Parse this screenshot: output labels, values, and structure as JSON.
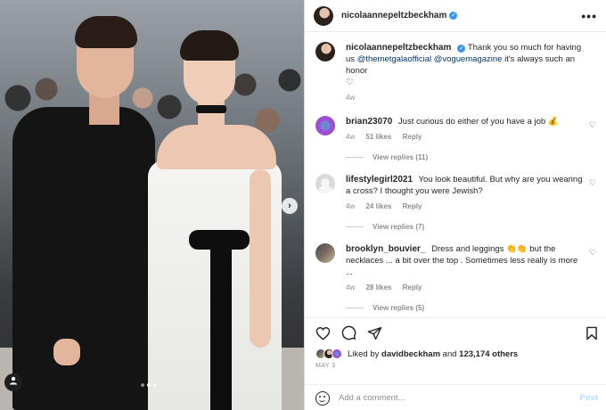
{
  "post": {
    "author": "nicolaannepeltzbeckham",
    "caption_text": "Thank you so much for having us",
    "caption_mention_1": "@themetgalaofficial",
    "caption_mention_2": "@voguemagazine",
    "caption_end": "it's always such an honor",
    "caption_emoji": "♡",
    "caption_age": "4w"
  },
  "header": {
    "more_icon": "•••"
  },
  "comments": [
    {
      "user": "brian23070",
      "text": "Just curious do either of you have a job 💰",
      "age": "4w",
      "likes": "51 likes",
      "reply": "Reply",
      "view_replies": "View replies (11)"
    },
    {
      "user": "lifestylegirl2021",
      "text": "You look beautiful. But why are you wearing a cross? I thought you were Jewish?",
      "age": "4w",
      "likes": "24 likes",
      "reply": "Reply",
      "view_replies": "View replies (7)"
    },
    {
      "user": "brooklyn_bouvier_",
      "text": "Dress and leggings 👏👏 but the necklaces ... a bit over the top . Sometimes less really is more ...",
      "age": "4w",
      "likes": "28 likes",
      "reply": "Reply",
      "view_replies": "View replies (5)"
    }
  ],
  "likes": {
    "prefix": "Liked by",
    "user": "davidbeckham",
    "and": "and",
    "count": "123,174 others"
  },
  "date": "MAY 3",
  "add_comment": {
    "placeholder": "Add a comment...",
    "post": "Post"
  },
  "carousel": {
    "next_arrow": "›",
    "active_index": 1,
    "total": 3
  },
  "colors": {
    "verified": "#3897f0",
    "mention": "#00376b",
    "muted": "#8e8e8e",
    "post_disabled": "#b2dffc"
  }
}
